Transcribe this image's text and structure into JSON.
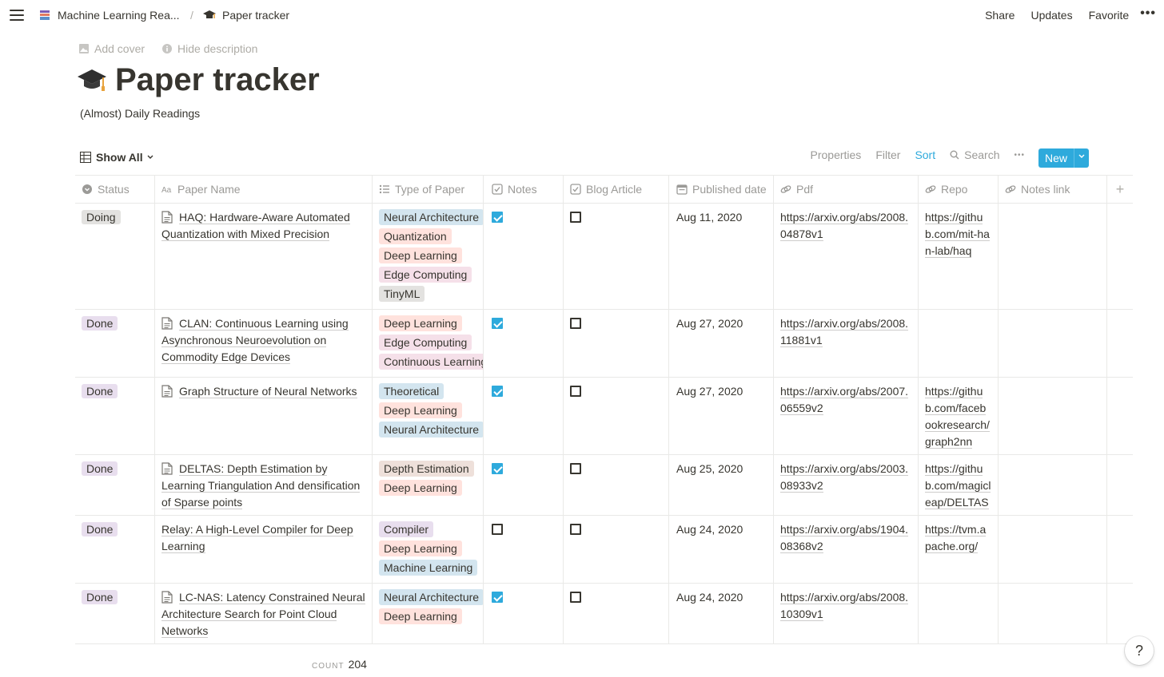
{
  "topbar": {
    "breadcrumb_parent": "Machine Learning Rea...",
    "breadcrumb_separator": "/",
    "breadcrumb_current": "Paper tracker",
    "actions": [
      "Share",
      "Updates",
      "Favorite"
    ],
    "more": "•••"
  },
  "page": {
    "add_cover": "Add cover",
    "hide_description": "Hide description",
    "title": "Paper tracker",
    "description": "(Almost) Daily Readings"
  },
  "view": {
    "name": "Show All",
    "properties": "Properties",
    "filter": "Filter",
    "sort": "Sort",
    "search": "Search",
    "more": "•••",
    "new_label": "New"
  },
  "columns": [
    "Status",
    "Paper Name",
    "Type of Paper",
    "Notes",
    "Blog Article",
    "Published date",
    "Pdf",
    "Repo",
    "Notes link"
  ],
  "colors": {
    "accent": "#2eaadc",
    "status_doing": "#e3e2e0",
    "status_done": "#e8deee",
    "tag_blue": "#d3e5ef",
    "tag_red": "#ffe2dd",
    "tag_pink": "#f5e0e9",
    "tag_gray": "#e3e2e0",
    "tag_brown": "#eee0da",
    "tag_purple": "#e8deee"
  },
  "rows": [
    {
      "status": "Doing",
      "name": "HAQ: Hardware-Aware Automated Quantization with Mixed Precision",
      "has_page_icon": true,
      "types": [
        "Neural Architecture",
        "Quantization",
        "Deep Learning",
        "Edge Computing",
        "TinyML"
      ],
      "notes": true,
      "blog": false,
      "date": "Aug 11, 2020",
      "pdf": "https://arxiv.org/abs/2008.04878v1",
      "repo": "https://github.com/mit-han-lab/haq",
      "notes_link": ""
    },
    {
      "status": "Done",
      "name": "CLAN: Continuous Learning using Asynchronous Neuroevolution on Commodity Edge Devices",
      "has_page_icon": true,
      "types": [
        "Deep Learning",
        "Edge Computing",
        "Continuous Learning"
      ],
      "notes": true,
      "blog": false,
      "date": "Aug 27, 2020",
      "pdf": "https://arxiv.org/abs/2008.11881v1",
      "repo": "",
      "notes_link": ""
    },
    {
      "status": "Done",
      "name": "Graph Structure of Neural Networks",
      "has_page_icon": true,
      "types": [
        "Theoretical",
        "Deep Learning",
        "Neural Architecture"
      ],
      "notes": true,
      "blog": false,
      "date": "Aug 27, 2020",
      "pdf": "https://arxiv.org/abs/2007.06559v2",
      "repo": "https://github.com/facebookresearch/graph2nn",
      "notes_link": ""
    },
    {
      "status": "Done",
      "name": "DELTAS: Depth Estimation by Learning Triangulation And densification of Sparse points",
      "has_page_icon": true,
      "types": [
        "Depth Estimation",
        "Deep Learning"
      ],
      "notes": true,
      "blog": false,
      "date": "Aug 25, 2020",
      "pdf": "https://arxiv.org/abs/2003.08933v2",
      "repo": "https://github.com/magicleap/DELTAS",
      "notes_link": ""
    },
    {
      "status": "Done",
      "name": "Relay: A High-Level Compiler for Deep Learning",
      "has_page_icon": false,
      "types": [
        "Compiler",
        "Deep Learning",
        "Machine Learning"
      ],
      "notes": false,
      "blog": false,
      "date": "Aug 24, 2020",
      "pdf": "https://arxiv.org/abs/1904.08368v2",
      "repo": "https://tvm.apache.org/",
      "notes_link": ""
    },
    {
      "status": "Done",
      "name": "LC-NAS: Latency Constrained Neural Architecture Search for Point Cloud Networks",
      "has_page_icon": true,
      "types": [
        "Neural Architecture",
        "Deep Learning"
      ],
      "notes": true,
      "blog": false,
      "date": "Aug 24, 2020",
      "pdf": "https://arxiv.org/abs/2008.10309v1",
      "repo": "",
      "notes_link": ""
    }
  ],
  "footer": {
    "count_label": "COUNT",
    "count_value": "204",
    "help": "?"
  }
}
